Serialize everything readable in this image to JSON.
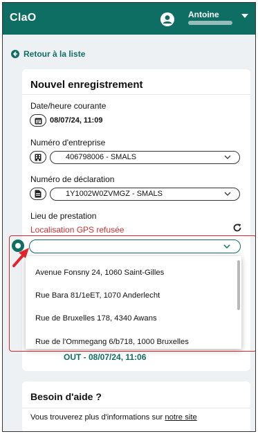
{
  "app": {
    "title": "ClaO"
  },
  "user": {
    "name": "Antoine"
  },
  "nav": {
    "back_label": "Retour à la liste"
  },
  "form": {
    "title": "Nouvel enregistrement",
    "datetime": {
      "label": "Date/heure courante",
      "value": "08/07/24, 11:09"
    },
    "company": {
      "label": "Numéro d'entreprise",
      "value": "406798006 - SMALS"
    },
    "declaration": {
      "label": "Numéro de déclaration",
      "value": "1Y1002W0ZVMGZ - SMALS"
    },
    "location": {
      "label": "Lieu de prestation",
      "error": "Localisation GPS refusée",
      "value": "",
      "options": [
        "Avenue Fonsny 24, 1060 Saint-Gilles",
        "Rue Bara 81/1eET, 1070 Anderlecht",
        "Rue de Bruxelles 178, 4340 Awans",
        "Rue de l'Ommegang 6/b718, 1000 Bruxelles"
      ]
    },
    "last_record": "OUT - 08/07/24, 11:06"
  },
  "help": {
    "title": "Besoin d'aide ?",
    "text": "Vous trouverez plus d'informations sur ",
    "link": "notre site"
  },
  "colors": {
    "brand": "#0f6e63",
    "error": "#d3302f",
    "highlight": "#e0262a"
  }
}
